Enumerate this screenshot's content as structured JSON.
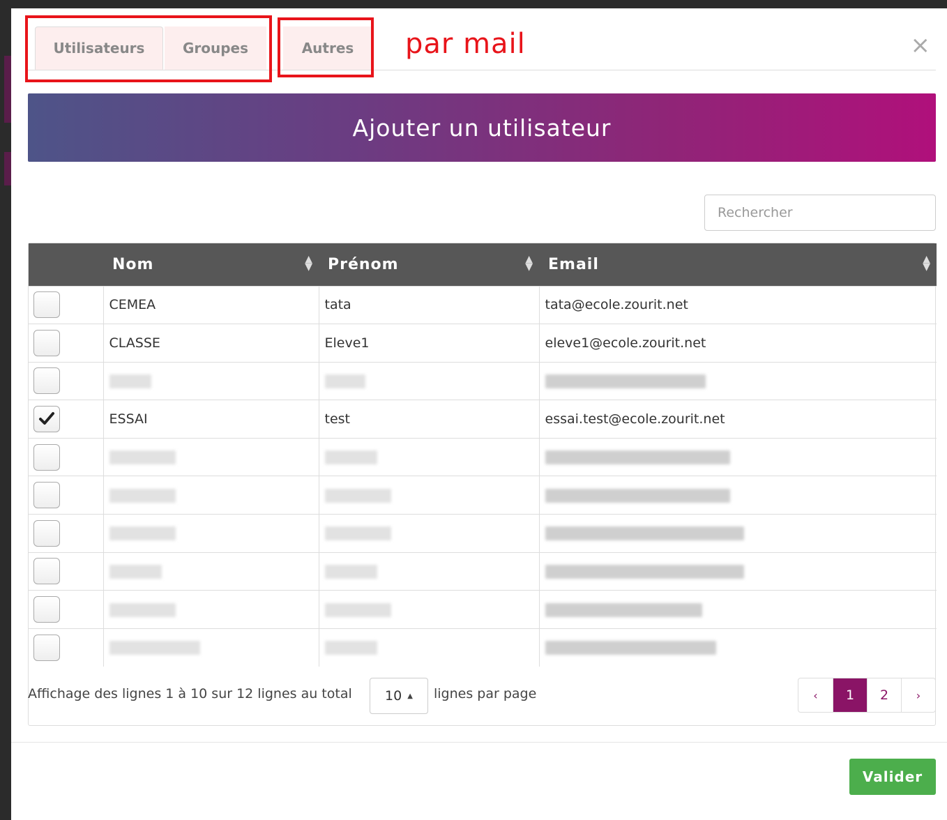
{
  "tabs": [
    {
      "label": "Utilisateurs",
      "active": true
    },
    {
      "label": "Groupes",
      "active": false
    },
    {
      "label": "Autres",
      "active": false
    }
  ],
  "annotation": "par mail",
  "close_symbol": "×",
  "banner": {
    "label": "Ajouter un utilisateur"
  },
  "search": {
    "placeholder": "Rechercher",
    "value": ""
  },
  "table": {
    "columns": [
      "Nom",
      "Prénom",
      "Email"
    ],
    "rows": [
      {
        "checked": false,
        "nom": "CEMEA",
        "prenom": "tata",
        "email": "tata@ecole.zourit.net",
        "redacted": false
      },
      {
        "checked": false,
        "nom": "CLASSE",
        "prenom": "Eleve1",
        "email": "eleve1@ecole.zourit.net",
        "redacted": false
      },
      {
        "checked": false,
        "nom": "",
        "prenom": "",
        "email": "",
        "redacted": true
      },
      {
        "checked": true,
        "nom": "ESSAI",
        "prenom": "test",
        "email": "essai.test@ecole.zourit.net",
        "redacted": false
      },
      {
        "checked": false,
        "nom": "",
        "prenom": "",
        "email": "",
        "redacted": true
      },
      {
        "checked": false,
        "nom": "",
        "prenom": "",
        "email": "",
        "redacted": true
      },
      {
        "checked": false,
        "nom": "",
        "prenom": "",
        "email": "",
        "redacted": true
      },
      {
        "checked": false,
        "nom": "",
        "prenom": "",
        "email": "",
        "redacted": true
      },
      {
        "checked": false,
        "nom": "",
        "prenom": "",
        "email": "",
        "redacted": true
      },
      {
        "checked": false,
        "nom": "",
        "prenom": "",
        "email": "",
        "redacted": true
      }
    ]
  },
  "pagination": {
    "info": "Affichage des lignes 1 à 10 sur 12 lignes au total",
    "page_size": "10",
    "per_page_label": "lignes par page",
    "prev": "‹",
    "next": "›",
    "pages": [
      "1",
      "2"
    ],
    "current_page": "1"
  },
  "submit_label": "Valider",
  "colors": {
    "highlight": "#e8141a",
    "banner_start": "#4e5488",
    "banner_end": "#b0107b",
    "header_bg": "#575757",
    "pager_active": "#8a1466",
    "submit": "#4cae4c"
  }
}
